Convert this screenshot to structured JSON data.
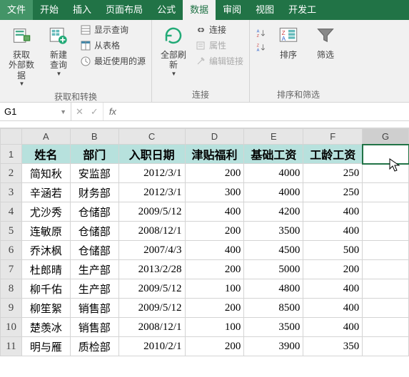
{
  "menu": {
    "items": [
      "文件",
      "开始",
      "插入",
      "页面布局",
      "公式",
      "数据",
      "审阅",
      "视图",
      "开发工"
    ],
    "active": 5
  },
  "ribbon": {
    "groups": [
      {
        "label": "获取和转换",
        "big": [
          {
            "name": "get-external-data",
            "label": "获取\n外部数据"
          },
          {
            "name": "new-query",
            "label": "新建\n查询"
          }
        ],
        "small": [
          {
            "name": "show-queries",
            "label": "显示查询"
          },
          {
            "name": "from-table",
            "label": "从表格"
          },
          {
            "name": "recent-sources",
            "label": "最近使用的源"
          }
        ]
      },
      {
        "label": "连接",
        "big": [
          {
            "name": "refresh-all",
            "label": "全部刷新"
          }
        ],
        "small": [
          {
            "name": "connections",
            "label": "连接"
          },
          {
            "name": "properties",
            "label": "属性"
          },
          {
            "name": "edit-links",
            "label": "编辑链接"
          }
        ]
      },
      {
        "label": "排序和筛选",
        "big": [
          {
            "name": "sort-asc",
            "label": ""
          },
          {
            "name": "sort",
            "label": "排序"
          },
          {
            "name": "filter",
            "label": "筛选"
          }
        ],
        "small": []
      }
    ]
  },
  "formulaBar": {
    "nameBox": "G1",
    "formula": ""
  },
  "columns": [
    "A",
    "B",
    "C",
    "D",
    "E",
    "F",
    "G"
  ],
  "headerRow": [
    "姓名",
    "部门",
    "入职日期",
    "津贴福利",
    "基础工资",
    "工龄工资",
    ""
  ],
  "rows": [
    {
      "r": 2,
      "a": "简知秋",
      "b": "安监部",
      "c": "2012/3/1",
      "d": "200",
      "e": "4000",
      "f": "250"
    },
    {
      "r": 3,
      "a": "辛涵若",
      "b": "财务部",
      "c": "2012/3/1",
      "d": "300",
      "e": "4000",
      "f": "250"
    },
    {
      "r": 4,
      "a": "尤沙秀",
      "b": "仓储部",
      "c": "2009/5/12",
      "d": "400",
      "e": "4200",
      "f": "400"
    },
    {
      "r": 5,
      "a": "连敏原",
      "b": "仓储部",
      "c": "2008/12/1",
      "d": "200",
      "e": "3500",
      "f": "400"
    },
    {
      "r": 6,
      "a": "乔沐枫",
      "b": "仓储部",
      "c": "2007/4/3",
      "d": "400",
      "e": "4500",
      "f": "500"
    },
    {
      "r": 7,
      "a": "杜郎晴",
      "b": "生产部",
      "c": "2013/2/28",
      "d": "200",
      "e": "5000",
      "f": "200"
    },
    {
      "r": 8,
      "a": "柳千佑",
      "b": "生产部",
      "c": "2009/5/12",
      "d": "100",
      "e": "4800",
      "f": "400"
    },
    {
      "r": 9,
      "a": "柳笙絮",
      "b": "销售部",
      "c": "2009/5/12",
      "d": "200",
      "e": "8500",
      "f": "400"
    },
    {
      "r": 10,
      "a": "楚羡冰",
      "b": "销售部",
      "c": "2008/12/1",
      "d": "100",
      "e": "3500",
      "f": "400"
    },
    {
      "r": 11,
      "a": "明与雁",
      "b": "质检部",
      "c": "2010/2/1",
      "d": "200",
      "e": "3900",
      "f": "350"
    }
  ],
  "selectedCell": "G1"
}
